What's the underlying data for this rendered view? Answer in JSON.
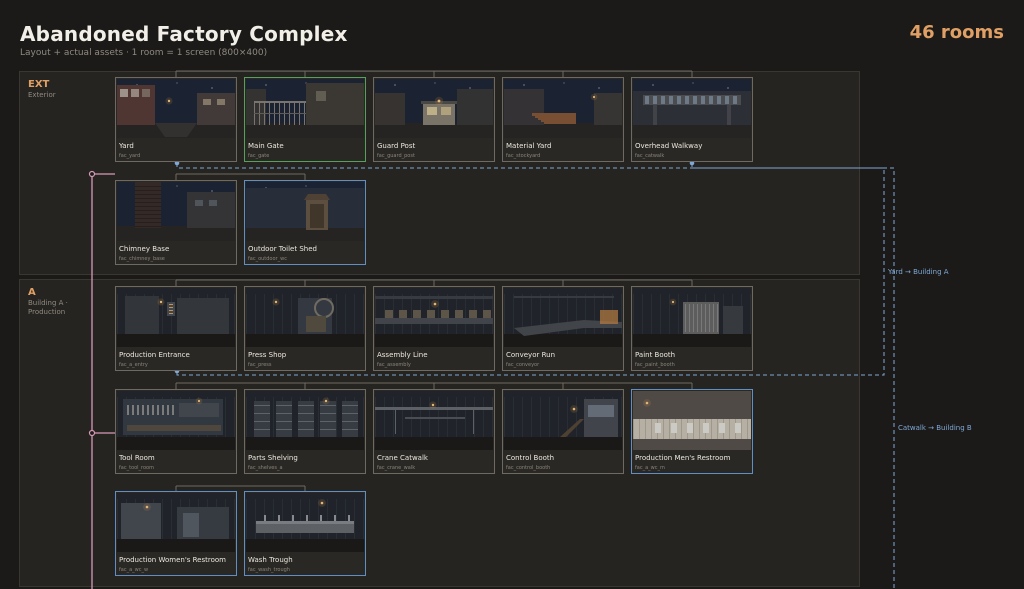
{
  "header": {
    "title": "Abandoned Factory Complex",
    "subtitle": "Layout + actual assets · 1 room = 1 screen (800×400)",
    "room_count": "46 rooms"
  },
  "colors": {
    "accent": "#e0a065",
    "link_blue": "#7fa8d6",
    "link_pink": "#d79ab8",
    "entry_border": "#56a05c",
    "special_border": "#5f8fc4"
  },
  "sections": [
    {
      "code": "EXT",
      "name": "Exterior",
      "rooms": [
        {
          "name": "Yard",
          "id": "fac_yard",
          "scene": "yard",
          "mark": "",
          "row": 0,
          "col": 0
        },
        {
          "name": "Main Gate",
          "id": "fac_gate",
          "scene": "gate",
          "mark": "entry",
          "row": 0,
          "col": 1
        },
        {
          "name": "Guard Post",
          "id": "fac_guard_post",
          "scene": "guard",
          "mark": "",
          "row": 0,
          "col": 2
        },
        {
          "name": "Material Yard",
          "id": "fac_stockyard",
          "scene": "stock",
          "mark": "",
          "row": 0,
          "col": 3
        },
        {
          "name": "Overhead Walkway",
          "id": "fac_catwalk",
          "scene": "catwalk",
          "mark": "",
          "row": 0,
          "col": 4
        },
        {
          "name": "Chimney Base",
          "id": "fac_chimney_base",
          "scene": "chimney",
          "mark": "",
          "row": 1,
          "col": 0
        },
        {
          "name": "Outdoor Toilet Shed",
          "id": "fac_outdoor_wc",
          "scene": "shed",
          "mark": "special",
          "row": 1,
          "col": 1
        }
      ]
    },
    {
      "code": "A",
      "name": "Building A · Production",
      "rooms": [
        {
          "name": "Production Entrance",
          "id": "fac_a_entry",
          "scene": "entry",
          "mark": "",
          "row": 0,
          "col": 0
        },
        {
          "name": "Press Shop",
          "id": "fac_press",
          "scene": "press",
          "mark": "",
          "row": 0,
          "col": 1
        },
        {
          "name": "Assembly Line",
          "id": "fac_assembly",
          "scene": "assembly",
          "mark": "",
          "row": 0,
          "col": 2
        },
        {
          "name": "Conveyor Run",
          "id": "fac_conveyor",
          "scene": "conveyor",
          "mark": "",
          "row": 0,
          "col": 3
        },
        {
          "name": "Paint Booth",
          "id": "fac_paint_booth",
          "scene": "paint",
          "mark": "",
          "row": 0,
          "col": 4
        },
        {
          "name": "Tool Room",
          "id": "fac_tool_room",
          "scene": "tool",
          "mark": "",
          "row": 1,
          "col": 0
        },
        {
          "name": "Parts Shelving",
          "id": "fac_shelves_a",
          "scene": "shelves",
          "mark": "",
          "row": 1,
          "col": 1
        },
        {
          "name": "Crane Catwalk",
          "id": "fac_crane_walk",
          "scene": "crane",
          "mark": "",
          "row": 1,
          "col": 2
        },
        {
          "name": "Control Booth",
          "id": "fac_control_booth",
          "scene": "control",
          "mark": "",
          "row": 1,
          "col": 3
        },
        {
          "name": "Production Men's Restroom",
          "id": "fac_a_wc_m",
          "scene": "restroom_m",
          "mark": "special",
          "row": 1,
          "col": 4
        },
        {
          "name": "Production Women's Restroom",
          "id": "fac_a_wc_w",
          "scene": "restroom_w",
          "mark": "special",
          "row": 2,
          "col": 0
        },
        {
          "name": "Wash Trough",
          "id": "fac_wash_trough",
          "scene": "wash",
          "mark": "special",
          "row": 2,
          "col": 1
        }
      ]
    }
  ],
  "links": [
    {
      "label": "Yard → Building A"
    },
    {
      "label": "Catwalk → Building B"
    }
  ]
}
